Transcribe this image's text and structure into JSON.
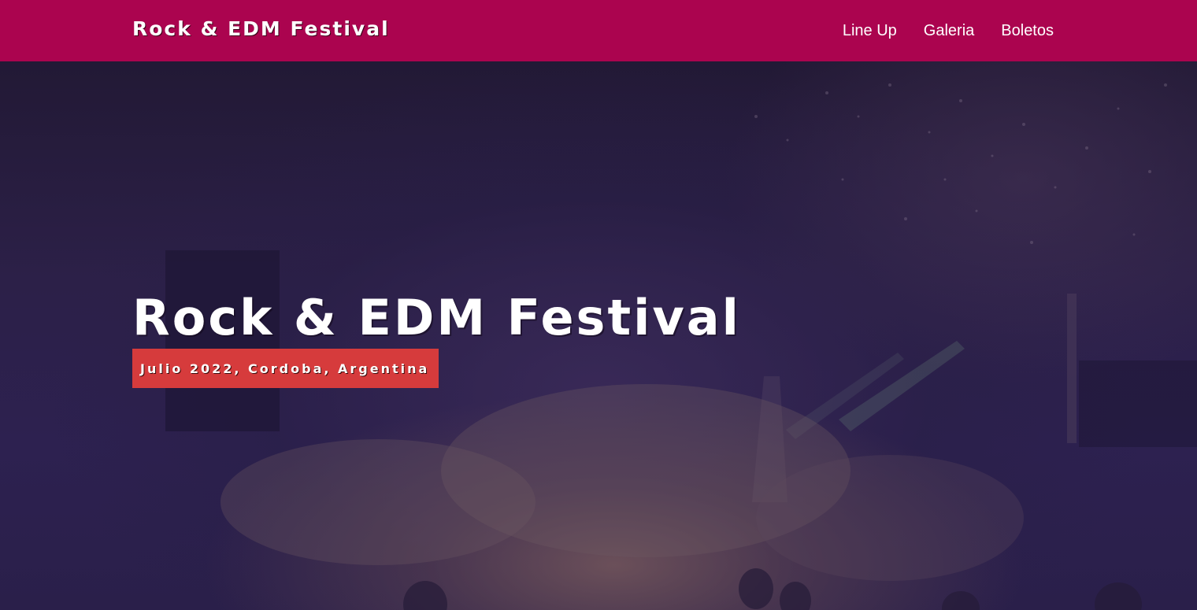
{
  "header": {
    "logo": "Rock & EDM Festival",
    "nav": [
      {
        "label": "Line Up"
      },
      {
        "label": "Galeria"
      },
      {
        "label": "Boletos"
      }
    ]
  },
  "hero": {
    "title": "Rock & EDM Festival",
    "subtitle": "Julio 2022, Cordoba, Argentina"
  },
  "colors": {
    "header_bg": "#ab044f",
    "badge_bg": "#d63b3c",
    "hero_overlay": "#2c2048",
    "text": "#ffffff"
  }
}
